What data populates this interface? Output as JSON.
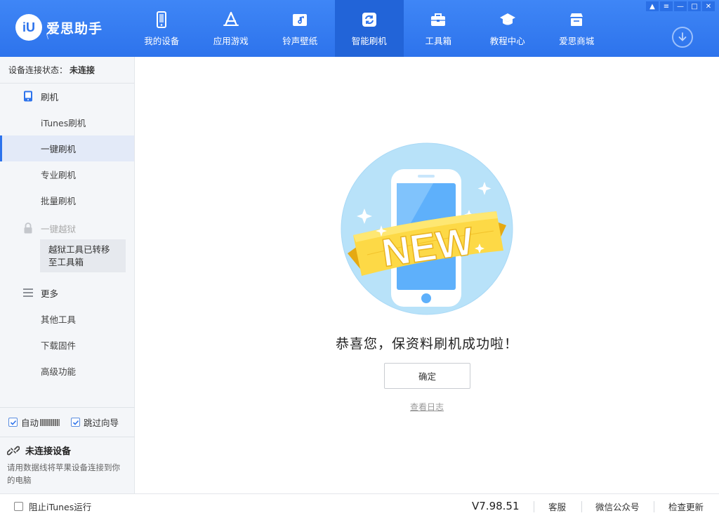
{
  "app": {
    "logo_mark": "iU",
    "name": "爱思助手",
    "sub": "\\",
    "accent": "#2d73ec"
  },
  "nav": [
    {
      "label": "我的设备",
      "icon": "phone-icon"
    },
    {
      "label": "应用游戏",
      "icon": "app-store-icon"
    },
    {
      "label": "铃声壁纸",
      "icon": "music-folder-icon"
    },
    {
      "label": "智能刷机",
      "icon": "refresh-icon",
      "active": true
    },
    {
      "label": "工具箱",
      "icon": "toolbox-icon"
    },
    {
      "label": "教程中心",
      "icon": "graduation-cap-icon"
    },
    {
      "label": "爱思商城",
      "icon": "store-icon"
    }
  ],
  "window_controls": [
    "shirt-icon",
    "list-icon",
    "minimize-icon",
    "maximize-icon",
    "close-icon"
  ],
  "sidebar": {
    "status_label": "设备连接状态：",
    "status_value": "未连接",
    "flash_head": "刷机",
    "flash_items": [
      "iTunes刷机",
      "一键刷机",
      "专业刷机",
      "批量刷机"
    ],
    "active_item": "一键刷机",
    "jailbreak_head": "一键越狱",
    "jailbreak_tip": "越狱工具已转移至工具箱",
    "more_head": "更多",
    "more_items": [
      "其他工具",
      "下载固件",
      "高级功能"
    ],
    "auto_label": "自动",
    "skip_label": "跳过向导",
    "device_title": "未连接设备",
    "device_desc": "请用数据线将苹果设备连接到你的电脑"
  },
  "main": {
    "badge_text": "NEW",
    "success_text": "恭喜您，保资料刷机成功啦！",
    "ok_label": "确定",
    "log_link": "查看日志"
  },
  "statusbar": {
    "itunes_label": "阻止iTunes运行",
    "version": "V7.98.51",
    "links": [
      "客服",
      "微信公众号",
      "检查更新"
    ]
  }
}
